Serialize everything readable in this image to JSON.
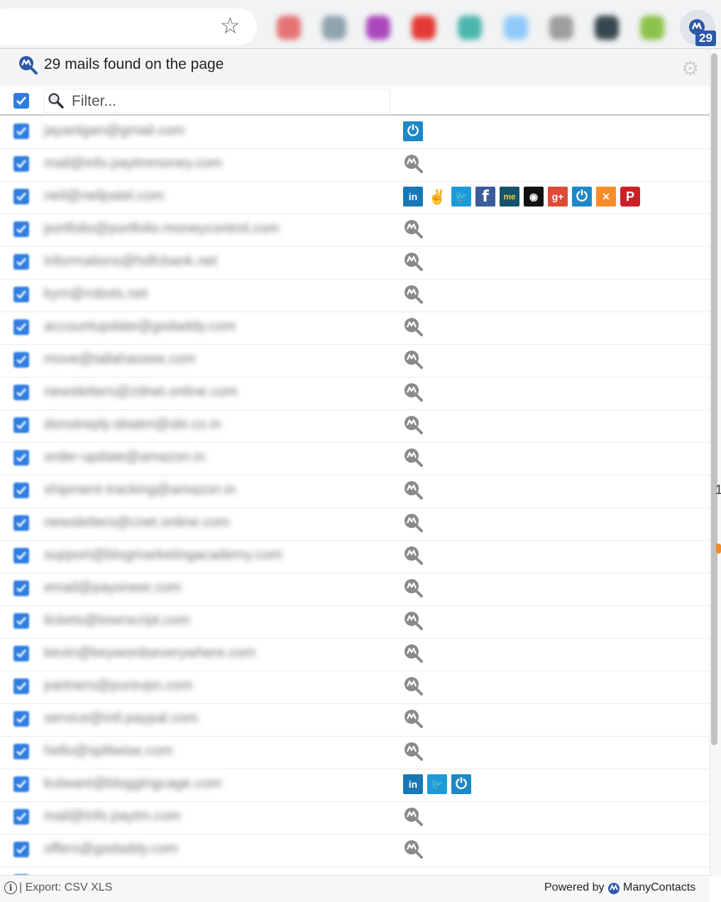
{
  "toolbar": {
    "bookmark_icon": "star-icon",
    "extension_colors": [
      "#e57373",
      "#90a4ae",
      "#ab47bc",
      "#e53935",
      "#4db6ac",
      "#90caf9",
      "#9e9e9e",
      "#37474f",
      "#8bc34a"
    ],
    "extension_badge": "29"
  },
  "header": {
    "title": "29 mails found on the page",
    "settings_icon": "gear-icon"
  },
  "filter": {
    "placeholder": "Filter..."
  },
  "rows": [
    {
      "email": "jayantgan@gmail.com",
      "socials": [
        "power"
      ]
    },
    {
      "email": "mail@info.paytmmoney.com",
      "socials": [
        "manycontacts-search"
      ]
    },
    {
      "email": "neil@neilpatel.com",
      "socials": [
        "linkedin",
        "angellist",
        "twitter",
        "facebook",
        "aboutme",
        "github",
        "googleplus",
        "power",
        "xing",
        "pinterest"
      ]
    },
    {
      "email": "portfolio@portfolio.moneycontrol.com",
      "socials": [
        "manycontacts-search"
      ]
    },
    {
      "email": "informations@hdfcbank.net",
      "socials": [
        "manycontacts-search"
      ]
    },
    {
      "email": "kym@robots.net",
      "socials": [
        "manycontacts-search"
      ]
    },
    {
      "email": "accountupdate@godaddy.com",
      "socials": [
        "manycontacts-search"
      ]
    },
    {
      "email": "move@tallahassee.com",
      "socials": [
        "manycontacts-search"
      ]
    },
    {
      "email": "newsletters@zdnet.online.com",
      "socials": [
        "manycontacts-search"
      ]
    },
    {
      "email": "donotreply.sbiatm@sbi.co.in",
      "socials": [
        "manycontacts-search"
      ]
    },
    {
      "email": "order-update@amazon.in",
      "socials": [
        "manycontacts-search"
      ]
    },
    {
      "email": "shipment-tracking@amazon.in",
      "socials": [
        "manycontacts-search"
      ]
    },
    {
      "email": "newsletters@cnet.online.com",
      "socials": [
        "manycontacts-search"
      ]
    },
    {
      "email": "support@blogmarketingacademy.com",
      "socials": [
        "manycontacts-search"
      ]
    },
    {
      "email": "email@payoneer.com",
      "socials": [
        "manycontacts-search"
      ]
    },
    {
      "email": "tickets@towrscript.com",
      "socials": [
        "manycontacts-search"
      ]
    },
    {
      "email": "kevin@keywordseverywhere.com",
      "socials": [
        "manycontacts-search"
      ]
    },
    {
      "email": "partners@purevpn.com",
      "socials": [
        "manycontacts-search"
      ]
    },
    {
      "email": "service@intl.paypal.com",
      "socials": [
        "manycontacts-search"
      ]
    },
    {
      "email": "hello@splitwise.com",
      "socials": [
        "manycontacts-search"
      ]
    },
    {
      "email": "kulwant@bloggingcage.com",
      "socials": [
        "linkedin",
        "twitter",
        "power"
      ]
    },
    {
      "email": "mail@info.paytm.com",
      "socials": [
        "manycontacts-search"
      ]
    },
    {
      "email": "offers@godaddy.com",
      "socials": [
        "manycontacts-search"
      ]
    },
    {
      "email": "",
      "socials": []
    }
  ],
  "social_styles": {
    "power": {
      "bg": "#1e88c7",
      "glyph": "⏻"
    },
    "linkedin": {
      "bg": "#1a77b5",
      "glyph": "in"
    },
    "angellist": {
      "bg": "#ffffff",
      "glyph": "✌"
    },
    "twitter": {
      "bg": "#1d9bd8",
      "glyph": "🐦"
    },
    "facebook": {
      "bg": "#3b5c9b",
      "glyph": "f"
    },
    "aboutme": {
      "bg": "#14546b",
      "glyph": "me"
    },
    "github": {
      "bg": "#111111",
      "glyph": "◉"
    },
    "googleplus": {
      "bg": "#dd4b39",
      "glyph": "g+"
    },
    "xing": {
      "bg": "#f78b2b",
      "glyph": "✕"
    },
    "pinterest": {
      "bg": "#cb2027",
      "glyph": "P"
    }
  },
  "footer": {
    "info_icon": "info-icon",
    "separator": "| Export:",
    "export_csv": "CSV",
    "export_xls": "XLS",
    "powered_by": "Powered by",
    "brand": "ManyContacts"
  }
}
